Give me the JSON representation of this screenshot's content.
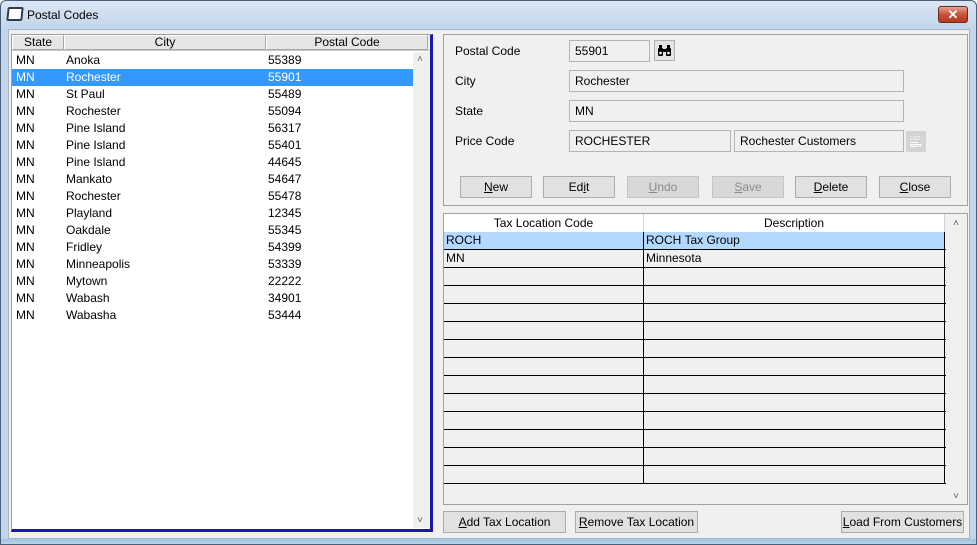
{
  "window": {
    "title": "Postal Codes",
    "close_label": "✕"
  },
  "list": {
    "columns": [
      "State",
      "City",
      "Postal Code"
    ],
    "selected_index": 1,
    "rows": [
      {
        "state": "MN",
        "city": "Anoka",
        "zip": "55389"
      },
      {
        "state": "MN",
        "city": "Rochester",
        "zip": "55901"
      },
      {
        "state": "MN",
        "city": "St Paul",
        "zip": "55489"
      },
      {
        "state": "MN",
        "city": "Rochester",
        "zip": "55094"
      },
      {
        "state": "MN",
        "city": "Pine Island",
        "zip": "56317"
      },
      {
        "state": "MN",
        "city": "Pine Island",
        "zip": "55401"
      },
      {
        "state": "MN",
        "city": "Pine Island",
        "zip": "44645"
      },
      {
        "state": "MN",
        "city": "Mankato",
        "zip": "54647"
      },
      {
        "state": "MN",
        "city": "Rochester",
        "zip": "55478"
      },
      {
        "state": "MN",
        "city": "Playland",
        "zip": "12345"
      },
      {
        "state": "MN",
        "city": "Oakdale",
        "zip": "55345"
      },
      {
        "state": "MN",
        "city": "Fridley",
        "zip": "54399"
      },
      {
        "state": "MN",
        "city": "Minneapolis",
        "zip": "53339"
      },
      {
        "state": "MN",
        "city": "Mytown",
        "zip": "22222"
      },
      {
        "state": "MN",
        "city": "Wabash",
        "zip": "34901"
      },
      {
        "state": "MN",
        "city": "Wabasha",
        "zip": "53444"
      }
    ]
  },
  "form": {
    "postal_code_label": "Postal Code",
    "postal_code_value": "55901",
    "city_label": "City",
    "city_value": "Rochester",
    "state_label": "State",
    "state_value": "MN",
    "price_code_label": "Price Code",
    "price_code_value": "ROCHESTER",
    "price_code_desc": "Rochester Customers",
    "search_icon": "binoculars-icon",
    "list_icon": "list-icon"
  },
  "buttons": {
    "new": {
      "ul": "N",
      "rest": "ew"
    },
    "edit": {
      "pre": "Ed",
      "ul": "i",
      "rest": "t"
    },
    "undo": {
      "ul": "U",
      "rest": "ndo"
    },
    "save": {
      "ul": "S",
      "rest": "ave"
    },
    "delete": {
      "ul": "D",
      "rest": "elete"
    },
    "close": {
      "ul": "C",
      "rest": "lose"
    },
    "add_tax": {
      "ul": "A",
      "rest": "dd Tax Location"
    },
    "remove_tax": {
      "ul": "R",
      "rest": "emove Tax Location"
    },
    "load": {
      "ul": "L",
      "rest": "oad From Customers"
    }
  },
  "tax_grid": {
    "columns": [
      "Tax Location Code",
      "Description"
    ],
    "selected_index": 0,
    "rows": [
      {
        "code": "ROCH",
        "desc": "ROCH Tax Group"
      },
      {
        "code": "MN",
        "desc": "Minnesota"
      },
      {
        "code": "",
        "desc": ""
      },
      {
        "code": "",
        "desc": ""
      },
      {
        "code": "",
        "desc": ""
      },
      {
        "code": "",
        "desc": ""
      },
      {
        "code": "",
        "desc": ""
      },
      {
        "code": "",
        "desc": ""
      },
      {
        "code": "",
        "desc": ""
      },
      {
        "code": "",
        "desc": ""
      },
      {
        "code": "",
        "desc": ""
      },
      {
        "code": "",
        "desc": ""
      },
      {
        "code": "",
        "desc": ""
      },
      {
        "code": "",
        "desc": ""
      }
    ]
  },
  "scroll": {
    "up": "˄",
    "down": "˅"
  }
}
